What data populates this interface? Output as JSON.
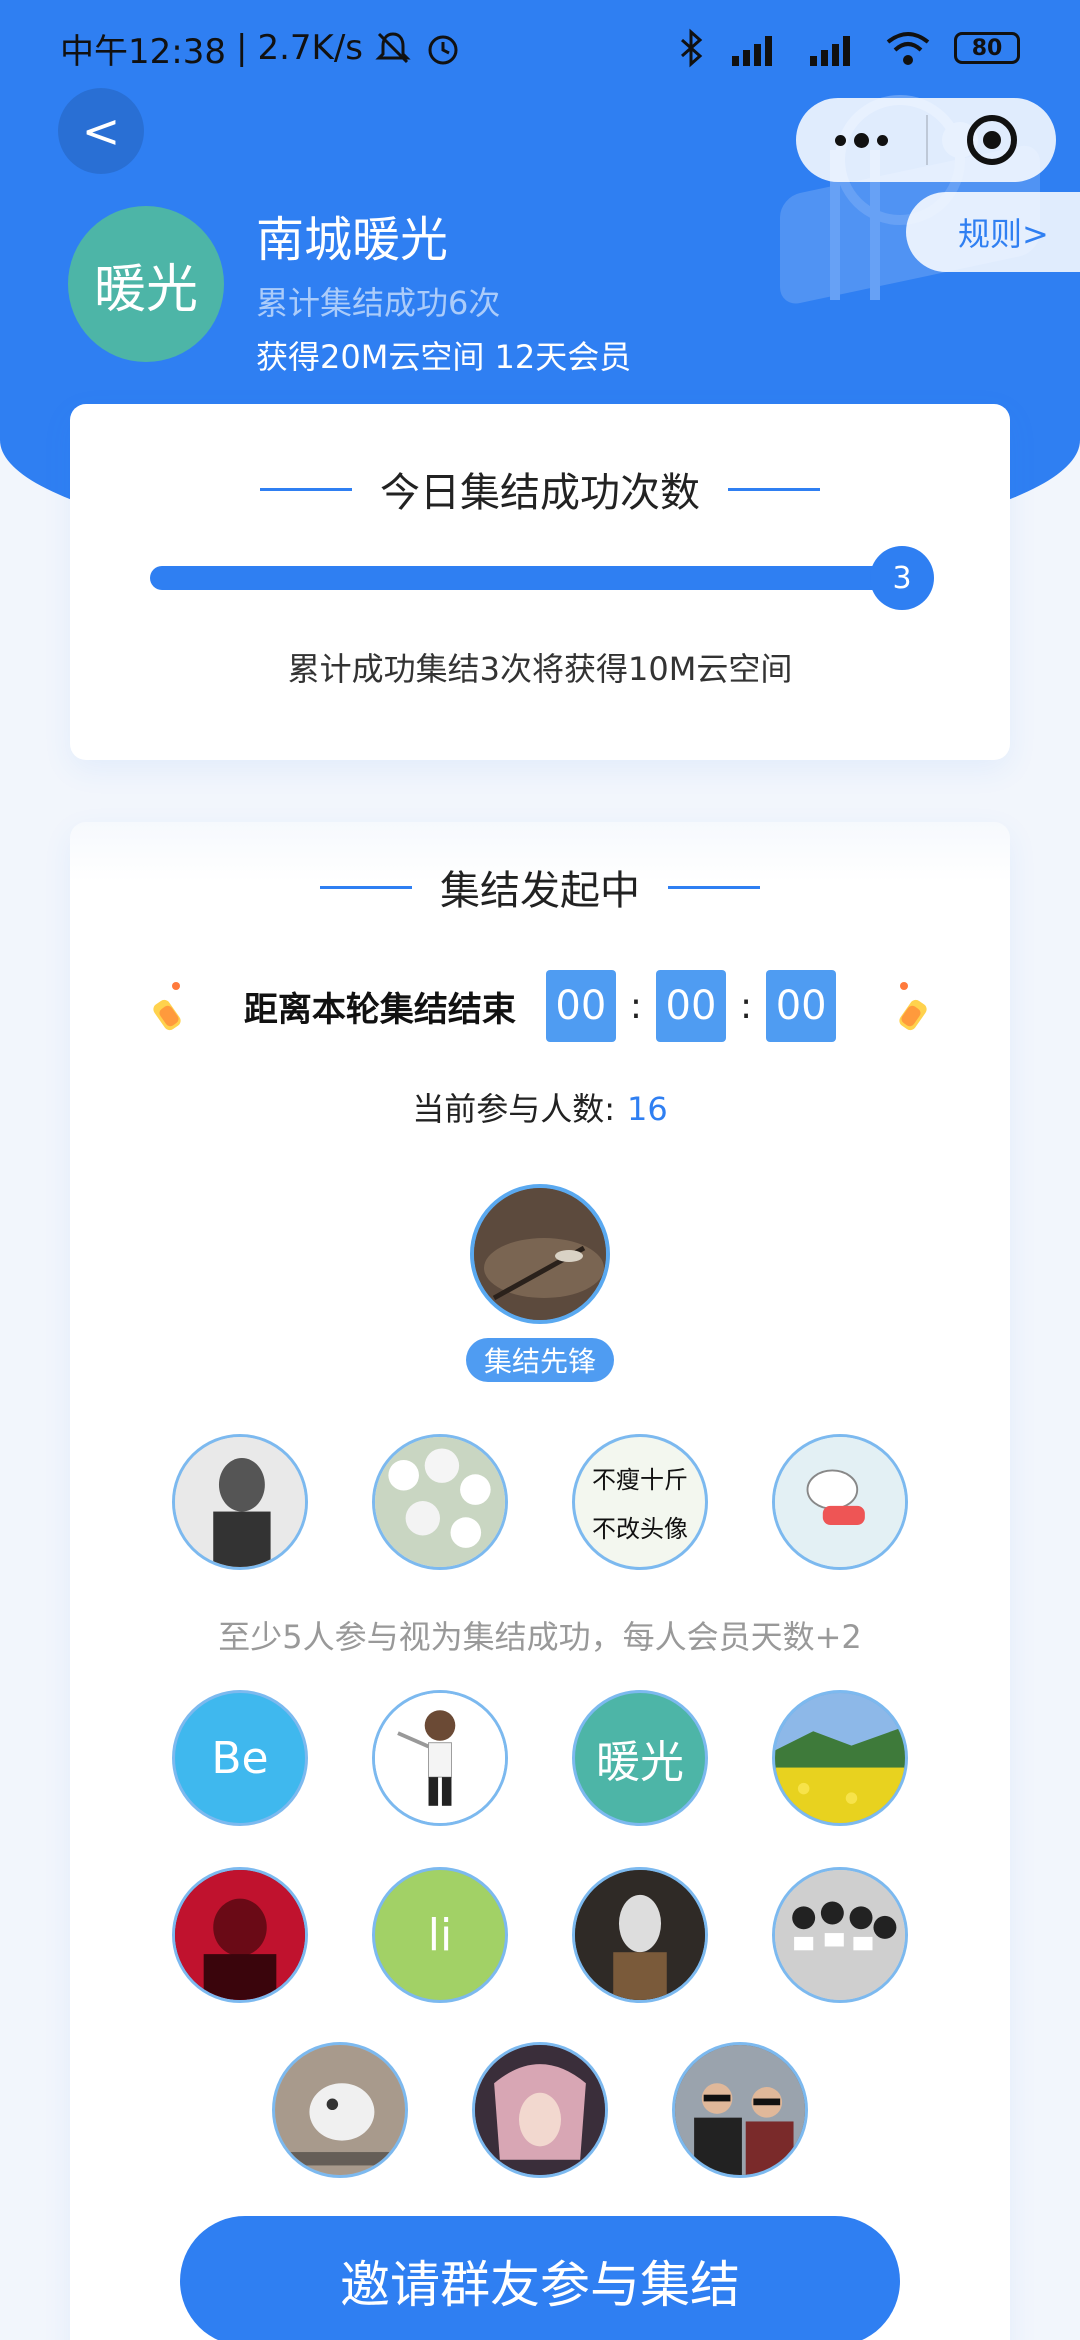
{
  "status_bar": {
    "time": "中午12:38",
    "separator": "|",
    "net_speed": "2.7K/s",
    "battery": "80",
    "icons": [
      "mute-bell-icon",
      "alarm-icon",
      "bluetooth-icon",
      "signal-hd-icon",
      "signal-hd-icon",
      "wifi-icon",
      "battery-icon"
    ]
  },
  "nav": {
    "back_label": "<",
    "rules_label": "规则>"
  },
  "user": {
    "avatar_text": "暖光",
    "name": "南城暖光",
    "total_success": "累计集结成功6次",
    "rewards": "获得20M云空间 12天会员"
  },
  "today": {
    "title": "今日集结成功次数",
    "progress_value": "3",
    "hint": "累计成功集结3次将获得10M云空间"
  },
  "rally": {
    "title": "集结发起中",
    "countdown_label": "距离本轮集结结束",
    "hours": "00",
    "minutes": "00",
    "seconds": "00",
    "colon": ":",
    "participants_label": "当前参与人数:",
    "participants_count": "16",
    "leader_badge": "集结先锋",
    "rule_text": "至少5人参与视为集结成功，每人会员天数+2",
    "invite_label": "邀请群友参与集结",
    "avatars_row1": [
      {
        "text": ""
      },
      {
        "text": ""
      },
      {
        "text": "不瘦十斤 不改头像",
        "line1": "不瘦十斤",
        "line2": "不改头像"
      },
      {
        "text": ""
      }
    ],
    "avatars_row2": [
      {
        "text": "Be"
      },
      {
        "text": ""
      },
      {
        "text": "暖光"
      },
      {
        "text": ""
      }
    ],
    "avatars_row3": [
      {
        "text": ""
      },
      {
        "text": "li"
      },
      {
        "text": ""
      },
      {
        "text": ""
      }
    ],
    "avatars_row4": [
      {
        "text": ""
      },
      {
        "text": ""
      },
      {
        "text": ""
      }
    ]
  },
  "colors": {
    "primary": "#2f7ff2",
    "teal_avatar": "#4db5a7",
    "cyan_avatar": "#3fb8ee",
    "green_avatar": "#a2d166"
  }
}
